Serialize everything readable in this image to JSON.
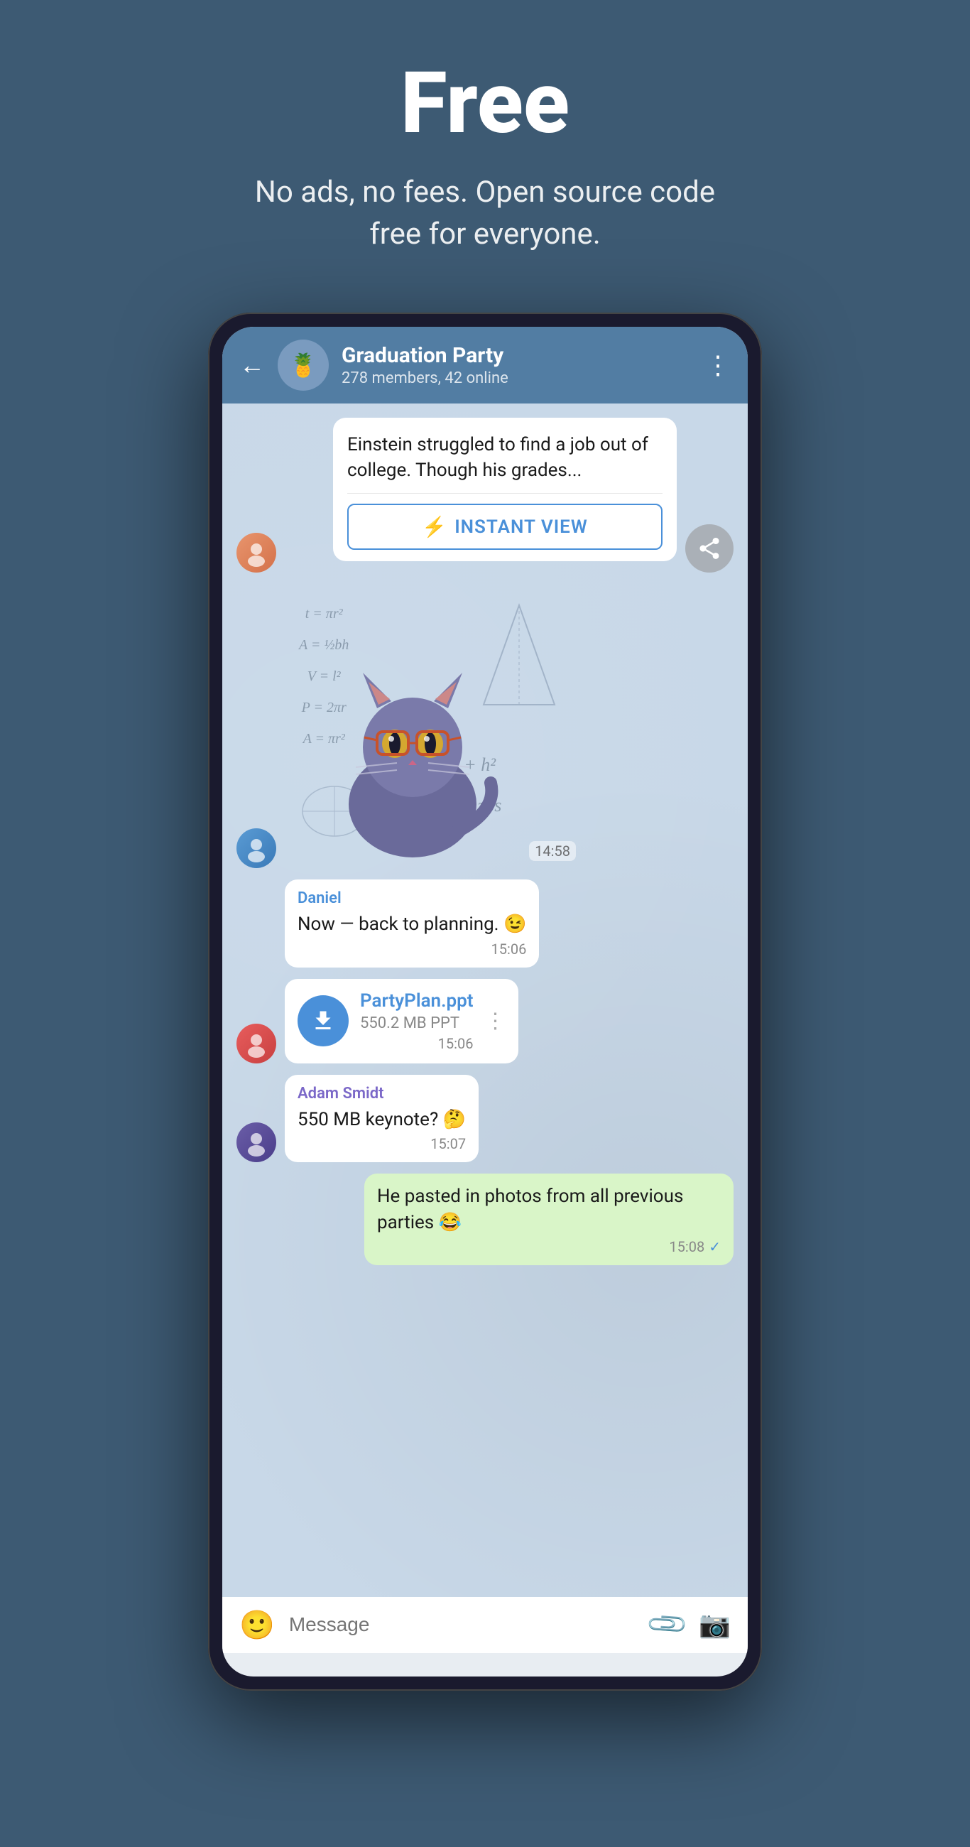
{
  "hero": {
    "title": "Free",
    "subtitle": "No ads, no fees. Open source code free for everyone."
  },
  "chat": {
    "header": {
      "group_name": "Graduation Party",
      "members_info": "278 members, 42 online",
      "back_label": "←",
      "more_label": "⋮",
      "avatar_emoji": "🍍"
    },
    "messages": [
      {
        "id": "instant-view-msg",
        "type": "instant_view",
        "text": "Einstein struggled to find a job out of college. Though his grades...",
        "button_label": "INSTANT VIEW",
        "sender_avatar": "avatar-1",
        "has_share": true
      },
      {
        "id": "sticker-msg",
        "type": "sticker",
        "time": "14:58",
        "sender_avatar": "avatar-2"
      },
      {
        "id": "daniel-msg",
        "type": "text",
        "sender": "Daniel",
        "text": "Now — back to planning. 😉",
        "time": "15:06",
        "align": "left"
      },
      {
        "id": "file-msg",
        "type": "file",
        "file_name": "PartyPlan.ppt",
        "file_size": "550.2 MB PPT",
        "time": "15:06",
        "align": "left"
      },
      {
        "id": "adam-msg",
        "type": "text",
        "sender": "Adam Smidt",
        "sender_class": "adam",
        "text": "550 MB keynote? 🤔",
        "time": "15:07",
        "align": "left"
      },
      {
        "id": "self-msg",
        "type": "text",
        "sender": null,
        "text": "He pasted in photos from all previous parties 😂",
        "time": "15:08",
        "align": "right",
        "checked": true
      }
    ],
    "input_placeholder": "Message",
    "math_formulas": [
      "t = nr²",
      "A = ...",
      "V = l²",
      "P = 2πr",
      "A = πr²",
      "s = √(r² + h²)",
      "A = πr² + πrs",
      "L"
    ]
  }
}
